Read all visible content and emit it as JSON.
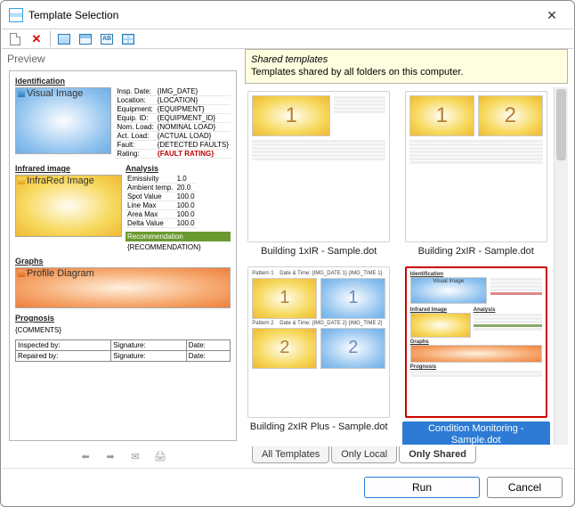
{
  "title": "Template Selection",
  "preview_label": "Preview",
  "info": {
    "heading": "Shared templates",
    "desc": "Templates shared by all folders on this computer."
  },
  "tabs": {
    "all": "All Templates",
    "local": "Only Local",
    "shared": "Only Shared",
    "active": "shared"
  },
  "buttons": {
    "run": "Run",
    "cancel": "Cancel"
  },
  "templates": [
    {
      "id": 0,
      "label": "Building 1xIR - Sample.dot"
    },
    {
      "id": 1,
      "label": "Building 2xIR - Sample.dot"
    },
    {
      "id": 2,
      "label": "Building 2xIR Plus - Sample.dot"
    },
    {
      "id": 3,
      "label": "Condition Monitoring - Sample.dot",
      "selected": true
    }
  ],
  "preview": {
    "sections": {
      "identification": "Identification",
      "infrared": "Infrared image",
      "analysis": "Analysis",
      "rec": "Recommendation",
      "graphs": "Graphs",
      "prognosis": "Prognosis"
    },
    "captions": {
      "visual": "Visual Image",
      "infrared": "InfraRed Image",
      "profile": "Profile Diagram"
    },
    "ident": [
      [
        "Insp. Date:",
        "{IMG_DATE}"
      ],
      [
        "Location:",
        "{LOCATION}"
      ],
      [
        "Equipment:",
        "{EQUIPMENT}"
      ],
      [
        "Equip. ID:",
        "{EQUIPMENT_ID}"
      ],
      [
        "Nom. Load:",
        "{NOMINAL LOAD}"
      ],
      [
        "Act. Load:",
        "{ACTUAL LOAD}"
      ],
      [
        "Fault:",
        "{DETECTED FAULTS}"
      ],
      [
        "Rating:",
        "{FAULT RATING}"
      ]
    ],
    "analysis": [
      [
        "Emissivity",
        "1.0"
      ],
      [
        "Ambient temp.",
        "20.0"
      ],
      [
        "Spot Value",
        "100.0"
      ],
      [
        "Line Max",
        "100.0"
      ],
      [
        "Area Max",
        "100.0"
      ],
      [
        "Delta Value",
        "100.0"
      ]
    ],
    "rec_text": "{RECOMMENDATION}",
    "comments": "{COMMENTS}",
    "sig": [
      [
        "Inspected by:",
        "Signature:",
        "Date:"
      ],
      [
        "Repaired by:",
        "Signature:",
        "Date:"
      ]
    ]
  }
}
